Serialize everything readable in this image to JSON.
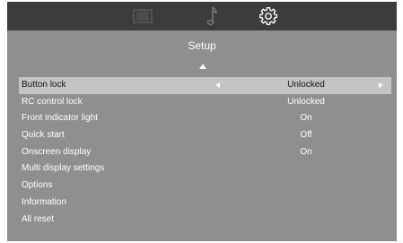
{
  "tabs": [
    {
      "icon": "display-icon",
      "active": false
    },
    {
      "icon": "music-note-icon",
      "active": false
    },
    {
      "icon": "gear-icon",
      "active": true
    }
  ],
  "title": "Setup",
  "menu": {
    "items": [
      {
        "label": "Button lock",
        "value": "Unlocked",
        "selected": true
      },
      {
        "label": "RC control lock",
        "value": "Unlocked"
      },
      {
        "label": "Front indicator light",
        "value": "On"
      },
      {
        "label": "Quick start",
        "value": "Off"
      },
      {
        "label": "Onscreen display",
        "value": "On"
      },
      {
        "label": "Multi display settings",
        "value": ""
      },
      {
        "label": "Options",
        "value": ""
      },
      {
        "label": "Information",
        "value": ""
      },
      {
        "label": "All reset",
        "value": ""
      }
    ]
  },
  "colors": {
    "background": "#8f8f8f",
    "topbar": "#3c3c3c",
    "selected_row": "#c4c4c4",
    "text": "#ffffff"
  }
}
